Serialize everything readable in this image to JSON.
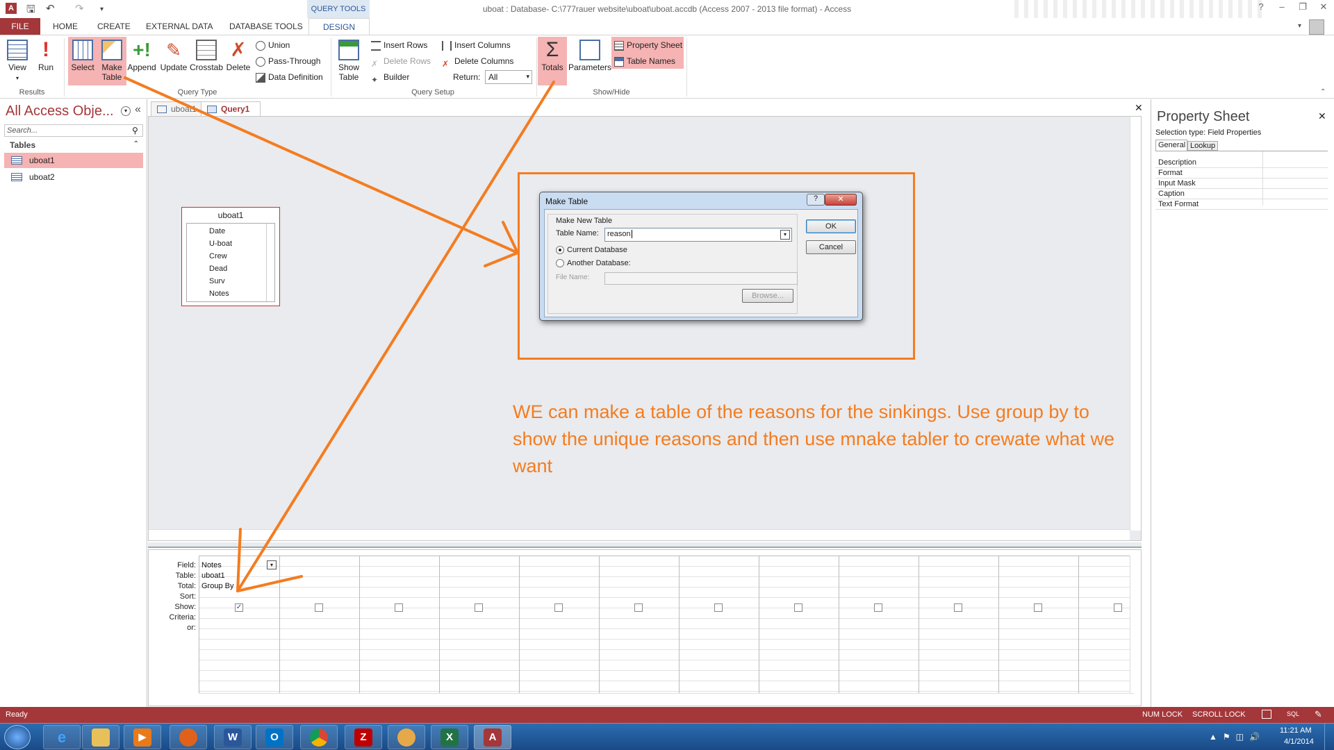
{
  "titlebar": {
    "title": "uboat : Database- C:\\777rauer website\\uboat\\uboat.accdb (Access 2007 - 2013 file format) - Access",
    "query_tools": "QUERY TOOLS",
    "help": "?",
    "minimize": "–",
    "restore": "❐",
    "close": "✕"
  },
  "tabs": [
    "FILE",
    "HOME",
    "CREATE",
    "EXTERNAL DATA",
    "DATABASE TOOLS",
    "DESIGN"
  ],
  "ribbon": {
    "results": {
      "label": "Results",
      "view": "View",
      "run": "Run"
    },
    "query_type": {
      "label": "Query Type",
      "select": "Select",
      "make_table": "Make\nTable",
      "append": "Append",
      "update": "Update",
      "crosstab": "Crosstab",
      "delete": "Delete",
      "union": "Union",
      "pass_through": "Pass-Through",
      "data_definition": "Data Definition"
    },
    "query_setup": {
      "label": "Query Setup",
      "show_table": "Show\nTable",
      "insert_rows": "Insert Rows",
      "delete_rows": "Delete Rows",
      "builder": "Builder",
      "insert_columns": "Insert Columns",
      "delete_columns": "Delete Columns",
      "return_label": "Return:",
      "return_value": "All"
    },
    "show_hide": {
      "label": "Show/Hide",
      "totals": "Totals",
      "parameters": "Parameters",
      "property_sheet": "Property Sheet",
      "table_names": "Table Names"
    }
  },
  "nav": {
    "title": "All Access Obje...",
    "search_placeholder": "Search...",
    "section": "Tables",
    "items": [
      "uboat1",
      "uboat2"
    ]
  },
  "doc_tabs": [
    "uboat1",
    "Query1"
  ],
  "field_list": {
    "title": "uboat1",
    "fields": [
      "Date",
      "U-boat",
      "Crew",
      "Dead",
      "Surv",
      "Notes"
    ]
  },
  "dialog": {
    "title": "Make Table",
    "help": "?",
    "close": "✕",
    "group": "Make New Table",
    "table_name_label": "Table Name:",
    "table_name_value": "reason",
    "current_db": "Current Database",
    "another_db": "Another Database:",
    "file_name_label": "File Name:",
    "browse": "Browse...",
    "ok": "OK",
    "cancel": "Cancel"
  },
  "annotation": "WE can make a table of the reasons for the sinkings. Use group by to show the unique reasons and then use mnake tabler to crewate what we want",
  "grid": {
    "row_labels": [
      "Field:",
      "Table:",
      "Total:",
      "Sort:",
      "Show:",
      "Criteria:",
      "or:"
    ],
    "col1": {
      "field": "Notes",
      "table": "uboat1",
      "total": "Group By"
    },
    "show_checked": [
      true,
      false,
      false,
      false,
      false,
      false,
      false,
      false,
      false,
      false,
      false,
      false
    ]
  },
  "property_sheet": {
    "title": "Property Sheet",
    "selection_type": "Selection type:  Field Properties",
    "tabs": [
      "General",
      "Lookup"
    ],
    "rows": [
      "Description",
      "Format",
      "Input Mask",
      "Caption",
      "Text Format"
    ]
  },
  "status": {
    "left": "Ready",
    "num_lock": "NUM LOCK",
    "scroll_lock": "SCROLL LOCK",
    "sql": "SQL"
  },
  "taskbar": {
    "time": "11:21 AM",
    "date": "4/1/2014"
  },
  "colors": {
    "access_red": "#a4373a",
    "annotation_orange": "#f47c20",
    "highlight": "#f5b3b3"
  }
}
